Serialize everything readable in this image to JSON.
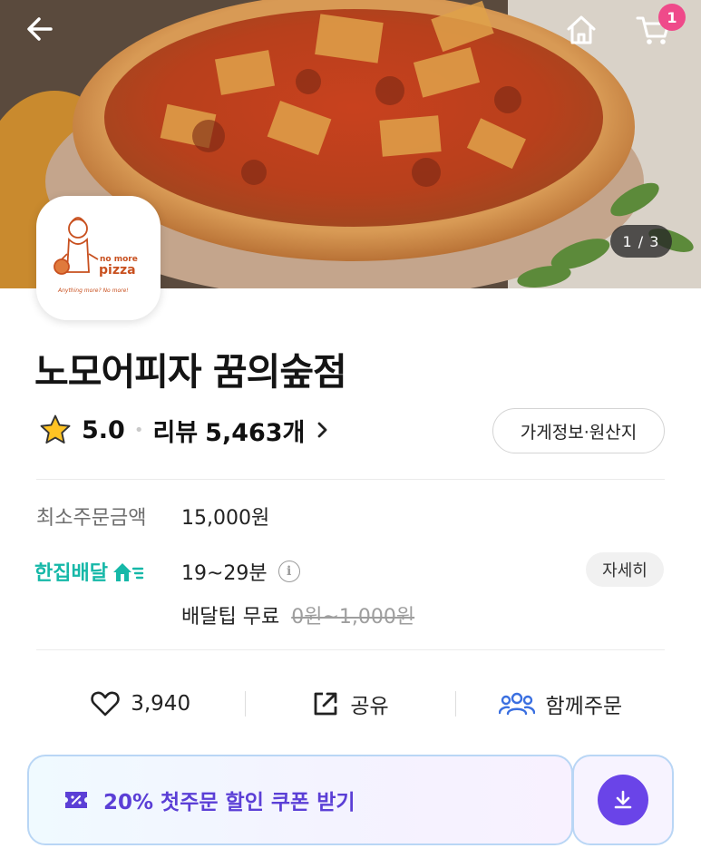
{
  "header": {
    "cart_badge": "1",
    "image_counter": "1 / 3"
  },
  "logo": {
    "text_line1": "no more",
    "text_line2": "pizza",
    "tagline": "Anything more? No more!"
  },
  "store": {
    "name": "노모어피자 꿈의숲점",
    "rating": "5.0",
    "review_label": "리뷰",
    "review_count": "5,463개",
    "info_button": "가게정보·원산지"
  },
  "order_info": {
    "min_order_label": "최소주문금액",
    "min_order_value": "15,000원",
    "delivery_brand": "한집배달",
    "delivery_time": "19~29분",
    "detail_button": "자세히",
    "tip_label": "배달팁 무료",
    "tip_original": "0원~1,000원"
  },
  "actions": {
    "like_count": "3,940",
    "share_label": "공유",
    "group_order_label": "함께주문"
  },
  "coupon": {
    "label": "20% 첫주문 할인 쿠폰 받기"
  },
  "colors": {
    "delivery_brand": "#16b8a8",
    "coupon_text": "#5b3fd6",
    "coupon_button": "#6a44e8",
    "badge": "#ef4a8a",
    "group_icon": "#3a6fe0"
  },
  "icons": [
    "back-arrow-icon",
    "home-icon",
    "cart-icon",
    "star-icon",
    "chevron-right-icon",
    "info-icon",
    "heart-icon",
    "share-icon",
    "group-icon",
    "coupon-icon",
    "download-icon"
  ]
}
